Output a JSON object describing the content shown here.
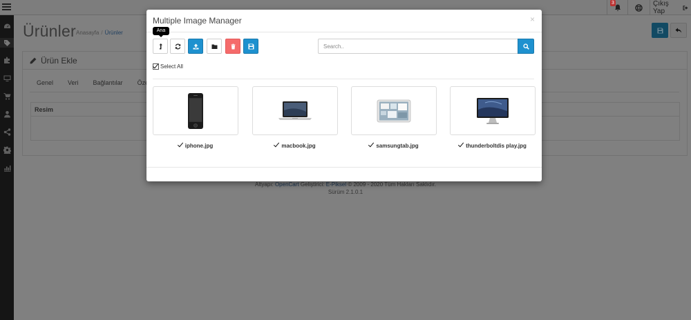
{
  "header": {
    "notification_count": "3",
    "logout_label": "Çıkış Yap"
  },
  "page": {
    "title": "Ürünler",
    "breadcrumb": [
      "Anasayfa",
      "Ürünler"
    ]
  },
  "panel": {
    "title": "Ürün Ekle",
    "tabs": [
      "Genel",
      "Veri",
      "Bağlantılar",
      "Özelli"
    ],
    "table_header": "Resim"
  },
  "footer": {
    "line1_pre": "Altyapı:",
    "line1_link1": "OpenCart",
    "line1_mid": "Geliştirici:",
    "line1_link2": "E-Piksel",
    "line1_post": "© 2009 - 2020 Tüm Hakları Saklıdır.",
    "line2": "Sürüm 2.1.0.1"
  },
  "modal": {
    "title": "Multiple Image Manager",
    "close": "×",
    "tooltip": "Ana",
    "search_placeholder": "Search..",
    "select_all": "Select All",
    "images": [
      {
        "name": "iphone.jpg",
        "checked": true
      },
      {
        "name": "macbook.jpg",
        "checked": true
      },
      {
        "name": "samsungtab.jpg",
        "checked": true
      },
      {
        "name": "thunderboltdis play.jpg",
        "checked": true
      }
    ]
  },
  "colors": {
    "primary": "#1e91cf",
    "danger": "#f56b6b",
    "sidebar": "#151515",
    "overlay_bg": "#808080"
  }
}
